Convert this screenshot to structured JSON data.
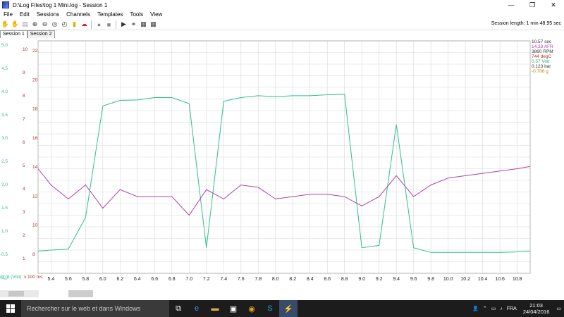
{
  "window": {
    "title": "D:\\Log Files\\log 1 Mini.log - Session 1",
    "controls": [
      "—",
      "❐",
      "✕"
    ]
  },
  "menu": [
    "File",
    "Edit",
    "Sessions",
    "Channels",
    "Templates",
    "Tools",
    "View"
  ],
  "toolbar": {
    "session_length": "Session length:  1 min 48.95 sec"
  },
  "tabs": [
    {
      "label": "Session 1",
      "active": true
    },
    {
      "label": "Session 2",
      "active": false
    }
  ],
  "legend": [
    {
      "text": "10.57 sec",
      "color": "#333333"
    },
    {
      "text": "14.33 AFR",
      "color": "#b040b0"
    },
    {
      "text": "3860 RPM",
      "color": "#333333"
    },
    {
      "text": "744 degC",
      "color": "#b03030"
    },
    {
      "text": "0.57 Volt",
      "color": "#20b070"
    },
    {
      "text": "0.123 bar",
      "color": "#333333"
    },
    {
      "text": "-0.706 g",
      "color": "#c08000"
    }
  ],
  "axes": {
    "volt_ticks": [
      "5.0",
      "4.5",
      "4.0",
      "3.5",
      "3.0",
      "2.5",
      "2.0",
      "1.5",
      "1.0",
      "0.5",
      "0.0"
    ],
    "afr_ticks": [
      "10",
      "9",
      "8",
      "7",
      "6",
      "5",
      "4",
      "3",
      "2",
      "1"
    ],
    "afr_ticks2": [
      "22",
      "20",
      "18",
      "16",
      "14",
      "12",
      "10",
      "8"
    ],
    "x_ticks": [
      "5.4",
      "5.6",
      "5.8",
      "6.0",
      "6.2",
      "6.4",
      "6.6",
      "6.8",
      "7.0",
      "7.2",
      "7.4",
      "7.6",
      "7.8",
      "8.0",
      "8.2",
      "8.4",
      "8.6",
      "8.8",
      "9.0",
      "9.2",
      "9.4",
      "9.6",
      "9.8",
      "10.0",
      "10.2",
      "10.4",
      "10.6",
      "10.8"
    ],
    "bottom_label": "(t)_3 (Volt)",
    "bottom_value": "x 100 ms"
  },
  "colors": {
    "volt": "#2fc08a",
    "afr": "#b040b0",
    "egt": "#b03030",
    "rpm": "#333355",
    "boost": "#3a3a6a",
    "grid": "#d8d8d8"
  },
  "chart_data": {
    "type": "line",
    "x": [
      5.25,
      5.4,
      5.6,
      5.8,
      6.0,
      6.2,
      6.4,
      6.6,
      6.8,
      7.0,
      7.2,
      7.4,
      7.6,
      7.8,
      8.0,
      8.2,
      8.4,
      8.6,
      8.8,
      9.0,
      9.2,
      9.4,
      9.6,
      9.8,
      10.0,
      10.2,
      10.4,
      10.6,
      10.8,
      10.95
    ],
    "series": [
      {
        "key": "volt",
        "values": [
          0.48,
          0.5,
          0.52,
          1.2,
          3.6,
          3.72,
          3.73,
          3.78,
          3.78,
          3.65,
          0.55,
          3.7,
          3.78,
          3.82,
          3.8,
          3.82,
          3.82,
          3.84,
          3.85,
          0.55,
          0.6,
          3.2,
          0.55,
          0.45,
          0.45,
          0.45,
          0.45,
          0.45,
          0.46,
          0.48
        ]
      },
      {
        "key": "afr",
        "values": [
          4.5,
          3.8,
          3.2,
          3.8,
          2.8,
          3.6,
          3.3,
          3.3,
          3.3,
          2.5,
          3.6,
          3.2,
          3.8,
          3.7,
          3.2,
          3.3,
          3.4,
          3.4,
          3.3,
          2.9,
          3.3,
          4.2,
          3.3,
          3.8,
          4.1,
          4.2,
          4.3,
          4.4,
          4.5,
          4.6
        ]
      }
    ]
  },
  "taskbar": {
    "search_placeholder": "Rechercher sur le web et dans Windows",
    "time": "21:03",
    "date": "24/04/2016",
    "lang": "FRA"
  }
}
